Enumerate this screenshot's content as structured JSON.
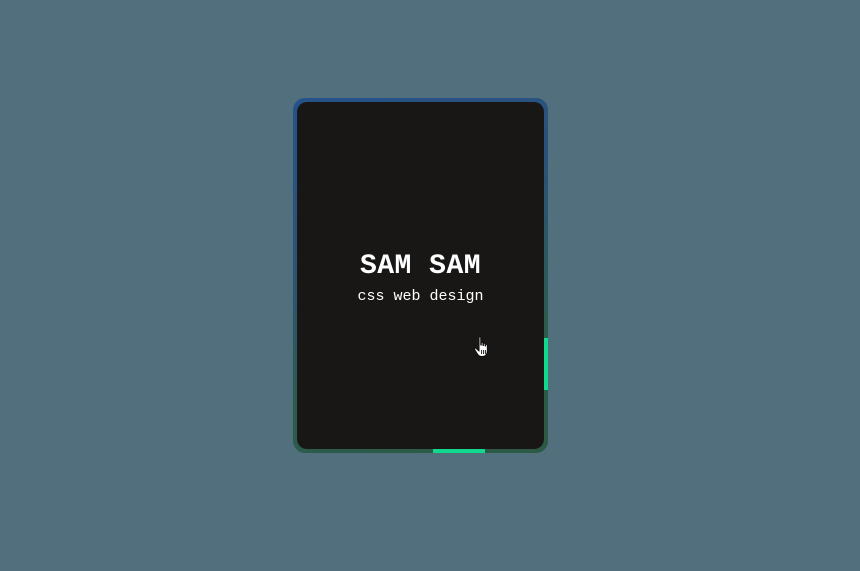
{
  "card": {
    "title": "SAM SAM",
    "subtitle": "css web design"
  },
  "colors": {
    "background": "#516f7c",
    "card_surface": "#181716",
    "accent": "#10d98e",
    "border_top": "#26528c",
    "border_bottom": "#2c5a44"
  },
  "icons": {
    "cursor": "hand-pointer-icon"
  }
}
